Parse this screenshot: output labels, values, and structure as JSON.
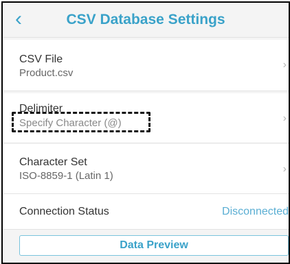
{
  "header": {
    "back_icon": "chevron-left-icon",
    "title": "CSV Database Settings"
  },
  "rows": [
    {
      "label": "CSV File",
      "value": "Product.csv",
      "icon": "chevron-right-icon"
    },
    {
      "label": "Delimiter",
      "value": "Specify Character (@)",
      "icon": "chevron-right-icon"
    },
    {
      "label": "Character Set",
      "value": "ISO-8859-1 (Latin 1)",
      "icon": "chevron-right-icon"
    }
  ],
  "status": {
    "label": "Connection Status",
    "value": "Disconnected"
  },
  "preview_button": "Data Preview",
  "colors": {
    "accent": "#3aa2c9",
    "status": "#5aaed3"
  }
}
